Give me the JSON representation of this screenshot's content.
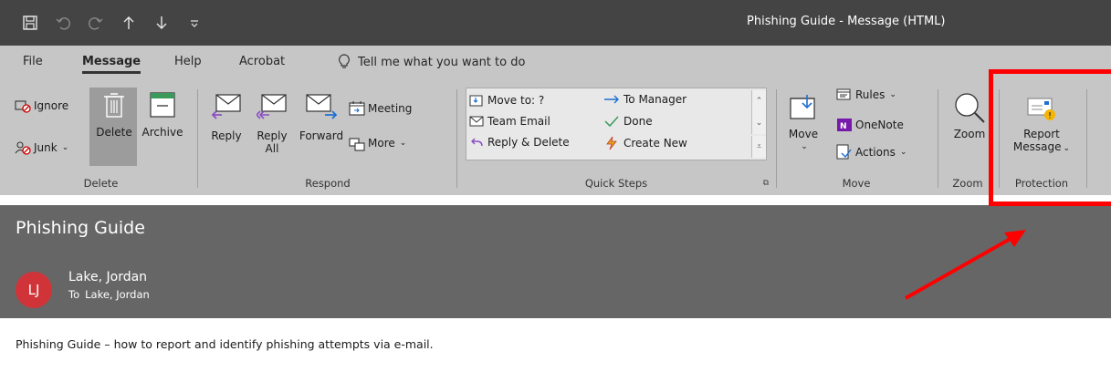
{
  "window": {
    "title": "Phishing Guide  -  Message (HTML)",
    "quick_access": [
      {
        "icon": "save-icon"
      },
      {
        "icon": "undo-icon"
      },
      {
        "icon": "redo-icon"
      },
      {
        "icon": "up-arrow-icon"
      },
      {
        "icon": "down-arrow-icon"
      },
      {
        "icon": "customize-qat-icon"
      }
    ]
  },
  "tabs": {
    "file": "File",
    "message": "Message",
    "help": "Help",
    "acrobat": "Acrobat",
    "tell_me": "Tell me what you want to do"
  },
  "ribbon": {
    "delete_group": {
      "label": "Delete",
      "ignore": "Ignore",
      "junk": "Junk",
      "delete": "Delete",
      "archive": "Archive"
    },
    "respond_group": {
      "label": "Respond",
      "reply": "Reply",
      "reply_all_line1": "Reply",
      "reply_all_line2": "All",
      "forward": "Forward",
      "meeting": "Meeting",
      "more": "More"
    },
    "quick_steps_group": {
      "label": "Quick Steps",
      "move_to": "Move to: ?",
      "team_email": "Team Email",
      "reply_delete": "Reply & Delete",
      "to_manager": "To Manager",
      "done": "Done",
      "create_new": "Create New"
    },
    "move_group": {
      "label": "Move",
      "move": "Move",
      "rules": "Rules",
      "onenote": "OneNote",
      "actions": "Actions"
    },
    "zoom_group": {
      "label": "Zoom",
      "zoom": "Zoom"
    },
    "protection_group": {
      "label": "Protection",
      "report_line1": "Report",
      "report_line2": "Message"
    }
  },
  "message": {
    "subject": "Phishing Guide",
    "avatar_initials": "LJ",
    "sender": "Lake, Jordan",
    "to_label": "To",
    "to_value": "Lake, Jordan",
    "body": "Phishing Guide – how to report and identify phishing attempts via e-mail."
  },
  "colors": {
    "title_bar": "#444444",
    "ribbon": "#c6c6c6",
    "message_header": "#666666",
    "avatar": "#d13438",
    "highlight": "#ff0000"
  }
}
